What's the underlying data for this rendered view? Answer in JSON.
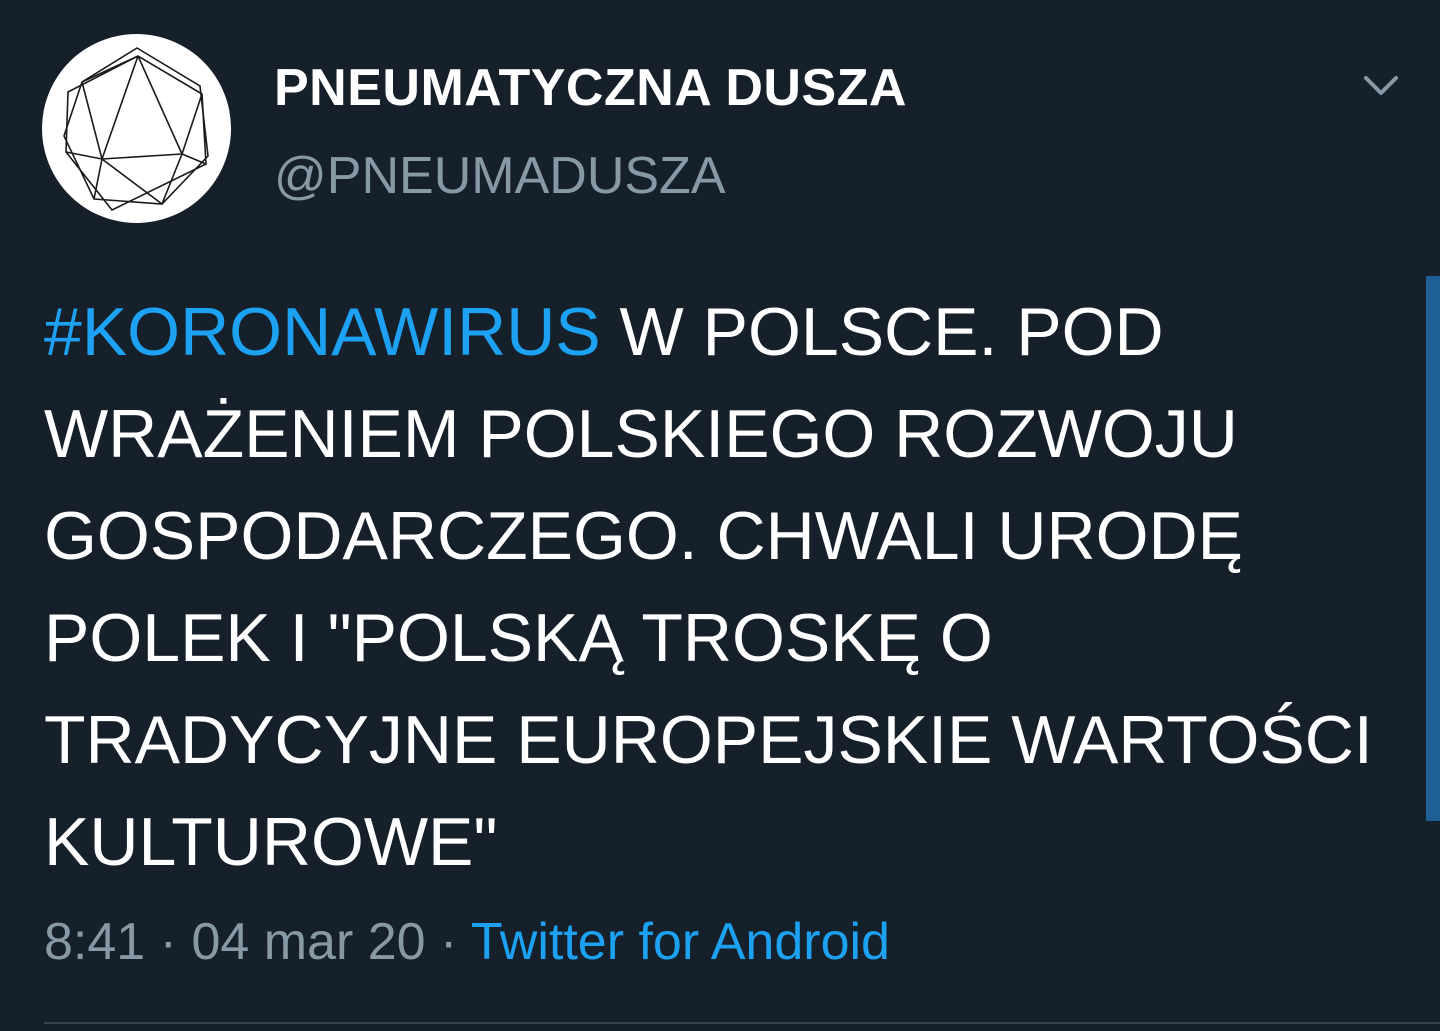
{
  "tweet": {
    "display_name": "PNEUMATYCZNA DUSZA",
    "handle": "@PNEUMADUSZA",
    "hashtag": "#KORONAWIRUS",
    "text_rest": " W POLSCE. POD WRAŻENIEM POLSKIEGO ROZWOJU GOSPODARCZEGO. CHWALI URODĘ POLEK I \"POLSKĄ TROSKĘ O TRADYCYJNE EUROPEJSKIE WARTOŚCI KULTUROWE\"",
    "time": "8:41",
    "date": "04 mar 20",
    "separator": "·",
    "source": "Twitter for Android"
  },
  "icons": {
    "avatar": "geometric-polyhedron-avatar",
    "menu": "chevron-down-icon"
  },
  "colors": {
    "background": "#15202b",
    "link": "#1da1f2",
    "secondary_text": "#8899a6",
    "scrollbar": "#1f5f97"
  }
}
